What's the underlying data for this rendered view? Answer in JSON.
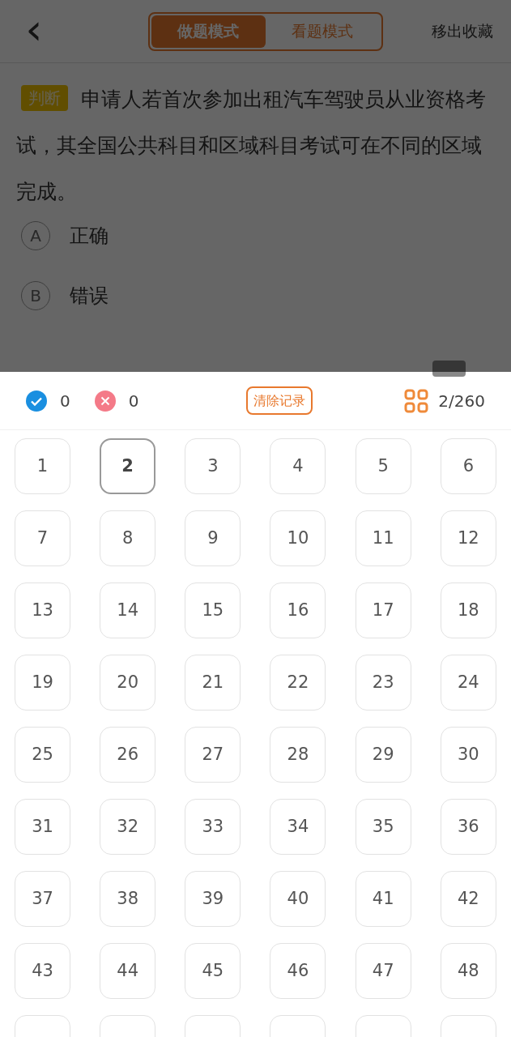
{
  "header": {
    "back": "‹",
    "modes": [
      {
        "label": "做题模式",
        "selected": true
      },
      {
        "label": "看题模式",
        "selected": false
      }
    ],
    "action": "移出收藏"
  },
  "question": {
    "tag": "判断",
    "text": "申请人若首次参加出租汽车驾驶员从业资格考试，其全国公共科目和区域科目考试可在不同的区域完成。",
    "options": [
      {
        "letter": "A",
        "text": "正确"
      },
      {
        "letter": "B",
        "text": "错误"
      }
    ]
  },
  "panel": {
    "correct_count": "0",
    "wrong_count": "0",
    "clear_button": "清除记录",
    "progress": "2/260",
    "items": [
      {
        "label": "1",
        "selected": false
      },
      {
        "label": "2",
        "selected": true
      },
      {
        "label": "3",
        "selected": false
      },
      {
        "label": "4",
        "selected": false
      },
      {
        "label": "5",
        "selected": false
      },
      {
        "label": "6",
        "selected": false
      },
      {
        "label": "7",
        "selected": false
      },
      {
        "label": "8",
        "selected": false
      },
      {
        "label": "9",
        "selected": false
      },
      {
        "label": "10",
        "selected": false
      },
      {
        "label": "11",
        "selected": false
      },
      {
        "label": "12",
        "selected": false
      },
      {
        "label": "13",
        "selected": false
      },
      {
        "label": "14",
        "selected": false
      },
      {
        "label": "15",
        "selected": false
      },
      {
        "label": "16",
        "selected": false
      },
      {
        "label": "17",
        "selected": false
      },
      {
        "label": "18",
        "selected": false
      },
      {
        "label": "19",
        "selected": false
      },
      {
        "label": "20",
        "selected": false
      },
      {
        "label": "21",
        "selected": false
      },
      {
        "label": "22",
        "selected": false
      },
      {
        "label": "23",
        "selected": false
      },
      {
        "label": "24",
        "selected": false
      },
      {
        "label": "25",
        "selected": false
      },
      {
        "label": "26",
        "selected": false
      },
      {
        "label": "27",
        "selected": false
      },
      {
        "label": "28",
        "selected": false
      },
      {
        "label": "29",
        "selected": false
      },
      {
        "label": "30",
        "selected": false
      },
      {
        "label": "31",
        "selected": false
      },
      {
        "label": "32",
        "selected": false
      },
      {
        "label": "33",
        "selected": false
      },
      {
        "label": "34",
        "selected": false
      },
      {
        "label": "35",
        "selected": false
      },
      {
        "label": "36",
        "selected": false
      },
      {
        "label": "37",
        "selected": false
      },
      {
        "label": "38",
        "selected": false
      },
      {
        "label": "39",
        "selected": false
      },
      {
        "label": "40",
        "selected": false
      },
      {
        "label": "41",
        "selected": false
      },
      {
        "label": "42",
        "selected": false
      },
      {
        "label": "43",
        "selected": false
      },
      {
        "label": "44",
        "selected": false
      },
      {
        "label": "45",
        "selected": false
      },
      {
        "label": "46",
        "selected": false
      },
      {
        "label": "47",
        "selected": false
      },
      {
        "label": "48",
        "selected": false
      }
    ]
  }
}
